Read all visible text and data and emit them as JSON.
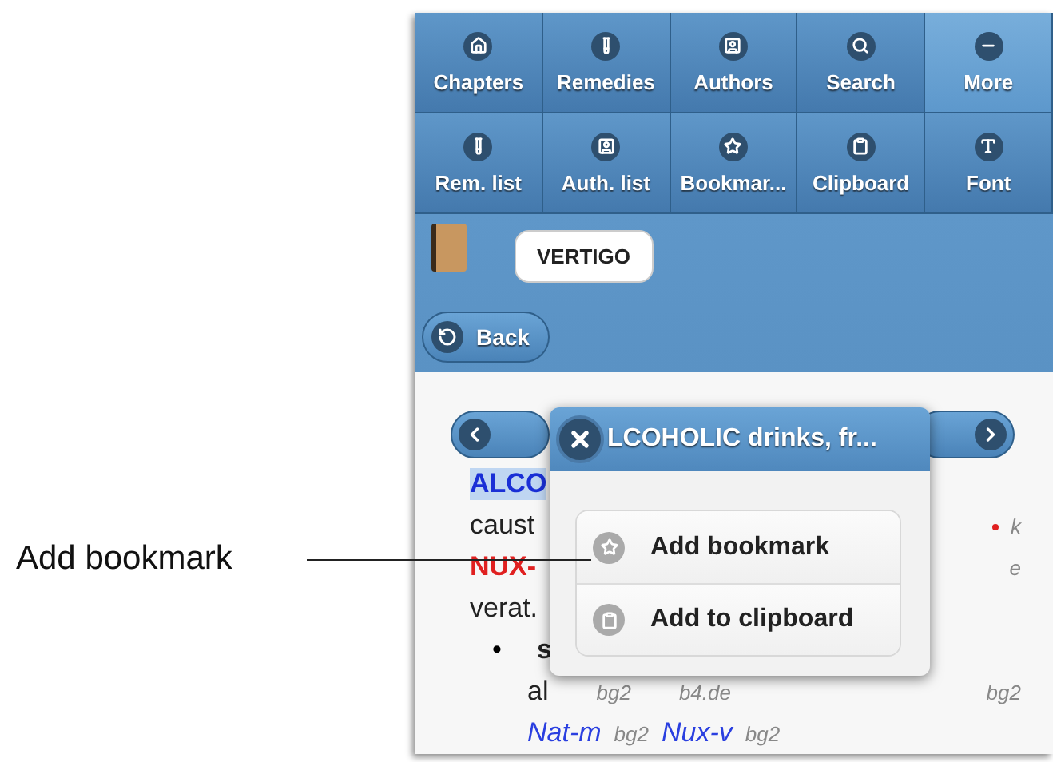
{
  "annotation": {
    "label": "Add bookmark"
  },
  "toolbar": {
    "rows": [
      [
        {
          "label": "Chapters",
          "selected": false
        },
        {
          "label": "Remedies",
          "selected": false
        },
        {
          "label": "Authors",
          "selected": false
        },
        {
          "label": "Search",
          "selected": false
        },
        {
          "label": "More",
          "selected": true
        }
      ],
      [
        {
          "label": "Rem. list",
          "selected": false
        },
        {
          "label": "Auth. list",
          "selected": false
        },
        {
          "label": "Bookmar...",
          "selected": false
        },
        {
          "label": "Clipboard",
          "selected": false
        },
        {
          "label": "Font",
          "selected": false
        }
      ]
    ]
  },
  "header": {
    "chapter_button": "VERTIGO",
    "back_button": "Back"
  },
  "content": {
    "lines": [
      {
        "kind": "top",
        "left": [
          {
            "kind": "highlight",
            "text": "ALCO"
          }
        ]
      },
      {
        "kind": "top",
        "left": [
          {
            "kind": "plain",
            "text": "caust"
          }
        ],
        "right": [
          {
            "kind": "mark"
          },
          {
            "kind": "grade",
            "text": "k"
          }
        ]
      },
      {
        "kind": "top",
        "left": [
          {
            "kind": "red",
            "text": "NUX-"
          }
        ],
        "right": [
          {
            "kind": "grade",
            "text": "e"
          }
        ]
      },
      {
        "kind": "top",
        "left": [
          {
            "kind": "plain",
            "text": "verat."
          }
        ]
      },
      {
        "kind": "bullet",
        "bullet": "•",
        "left": [
          {
            "kind": "bold",
            "text": "s"
          }
        ]
      },
      {
        "kind": "sub",
        "left": [
          {
            "kind": "plain",
            "text": "al"
          },
          {
            "kind": "grade",
            "text": "bg2"
          },
          {
            "kind": "grade",
            "text": "b4.de"
          }
        ],
        "right": [
          {
            "kind": "grade",
            "text": "bg2"
          }
        ]
      },
      {
        "kind": "sub",
        "left": [
          {
            "kind": "remedy",
            "text": "Nat-m"
          },
          {
            "kind": "grade",
            "text": "bg2"
          },
          {
            "kind": "remedy",
            "text": "Nux-v"
          },
          {
            "kind": "grade",
            "text": "bg2"
          }
        ]
      }
    ]
  },
  "popup": {
    "title": "LCOHOLIC drinks, fr...",
    "items": [
      "Add bookmark",
      "Add to clipboard"
    ]
  }
}
